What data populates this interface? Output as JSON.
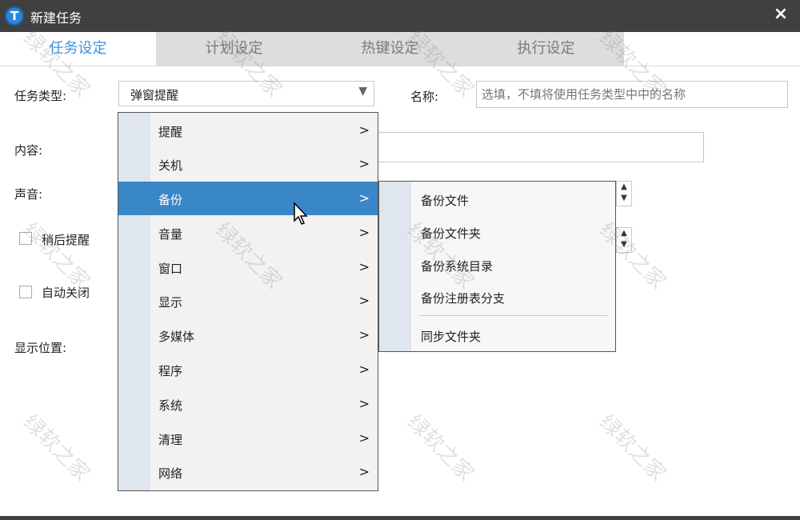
{
  "window": {
    "title": "新建任务",
    "app_icon": "T",
    "close": "×"
  },
  "tabs": [
    {
      "label": "任务设定",
      "active": true
    },
    {
      "label": "计划设定",
      "active": false
    },
    {
      "label": "热键设定",
      "active": false
    },
    {
      "label": "执行设定",
      "active": false
    }
  ],
  "form": {
    "task_type_label": "任务类型:",
    "task_type_value": "弹窗提醒",
    "name_label": "名称:",
    "name_placeholder": "选填，不填将使用任务类型中中的名称",
    "content_label": "内容:",
    "sound_label": "声音:",
    "later_remind_label": "稍后提醒",
    "auto_close_label": "自动关闭",
    "position_label": "显示位置:"
  },
  "menu": {
    "items": [
      {
        "label": "提醒"
      },
      {
        "label": "关机"
      },
      {
        "label": "备份",
        "highlighted": true
      },
      {
        "label": "音量"
      },
      {
        "label": "窗口"
      },
      {
        "label": "显示"
      },
      {
        "label": "多媒体"
      },
      {
        "label": "程序"
      },
      {
        "label": "系统"
      },
      {
        "label": "清理"
      },
      {
        "label": "网络"
      }
    ],
    "chevron": ">"
  },
  "submenu": {
    "items": [
      {
        "label": "备份文件"
      },
      {
        "label": "备份文件夹"
      },
      {
        "label": "备份系统目录"
      },
      {
        "label": "备份注册表分支"
      },
      {
        "label": "同步文件夹"
      }
    ]
  },
  "watermark": "绿软之家",
  "colors": {
    "titlebar": "#404040",
    "accent": "#3f8fe0",
    "highlight": "#3a87c8"
  }
}
